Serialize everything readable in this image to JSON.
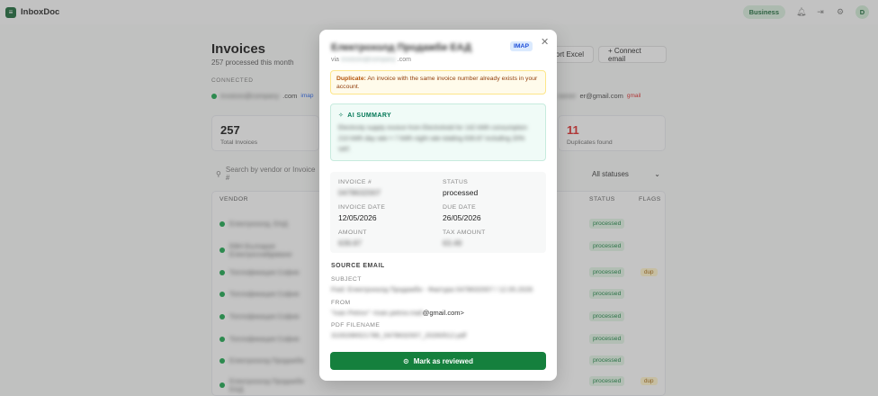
{
  "app": {
    "brand": "InboxDoc",
    "logo_glyph": "≡",
    "plan_badge": "Business",
    "avatar_initial": "D"
  },
  "page": {
    "title": "Invoices",
    "subtitle": "257 processed this month",
    "export_label": "Export Excel",
    "connect_label": "+ Connect email"
  },
  "connected": {
    "label": "CONNECTED",
    "accounts": [
      {
        "name_blurred": "invoices@company",
        "suffix": ".com",
        "type": "imap"
      },
      {
        "name_blurred": "owner",
        "suffix": "er@gmail.com",
        "type": "gmail"
      }
    ]
  },
  "stats": [
    {
      "value": "257",
      "label": "Total Invoices"
    },
    {
      "value": "11",
      "label": "Duplicates found"
    }
  ],
  "search": {
    "placeholder": "Search by vendor or Invoice #"
  },
  "filter": {
    "value": "All statuses"
  },
  "table": {
    "headers": {
      "vendor": "VENDOR",
      "status": "STATUS",
      "flags": "FLAGS"
    },
    "rows": [
      {
        "vendor": "Електрохолд, ЕАД",
        "status": "processed",
        "flag": ""
      },
      {
        "vendor": "ЕВН България Електроснабдяване",
        "status": "processed",
        "flag": ""
      },
      {
        "vendor": "Топлофикация София",
        "status": "processed",
        "flag": "dup"
      },
      {
        "vendor": "Топлофикация София",
        "status": "processed",
        "flag": ""
      },
      {
        "vendor": "Топлофикация София",
        "status": "processed",
        "flag": ""
      },
      {
        "vendor": "Топлофикация София",
        "status": "processed",
        "flag": ""
      },
      {
        "vendor": "Електрохолд Продажби",
        "status": "processed",
        "flag": ""
      },
      {
        "vendor": "Електрохолд Продажби ЕАД",
        "status": "processed",
        "flag": "dup"
      }
    ]
  },
  "modal": {
    "title": "Електрохолд Продажби ЕАД",
    "source_badge": "IMAP",
    "via_label": "via",
    "via_blurred": "invoices@company",
    "via_suffix": ".com",
    "duplicate_label": "Duplicate:",
    "duplicate_text": "An invoice with the same invoice number already exists in your account.",
    "ai_title": "AI SUMMARY",
    "ai_summary": "Electricity supply invoice from Electrohold for 142 kWh consumption 210 kWh day rate = 7 kWh night rate totaling 639.87 including 20% VAT.",
    "fields": {
      "invoice_no_label": "INVOICE #",
      "invoice_no_value": "0478632007",
      "status_label": "STATUS",
      "status_value": "processed",
      "invoice_date_label": "INVOICE DATE",
      "invoice_date_value": "12/05/2026",
      "due_date_label": "DUE DATE",
      "due_date_value": "26/05/2026",
      "amount_label": "AMOUNT",
      "amount_value": "639.87",
      "tax_label": "TAX AMOUNT",
      "tax_value": "63.49"
    },
    "source": {
      "heading": "SOURCE EMAIL",
      "subject_label": "SUBJECT",
      "subject_value": "Fwd: Електрохолд Продажби - Фактура 0478632007 / 12.05.2026",
      "from_label": "FROM",
      "from_blurred": "\"Ivan Petrov\" <ivan.petrov.mail",
      "from_suffix": "@gmail.com>",
      "pdf_label": "PDF FILENAME",
      "pdf_value": "3100286521786_0478632007_20260512.pdf"
    },
    "review_button": "Mark as reviewed"
  }
}
